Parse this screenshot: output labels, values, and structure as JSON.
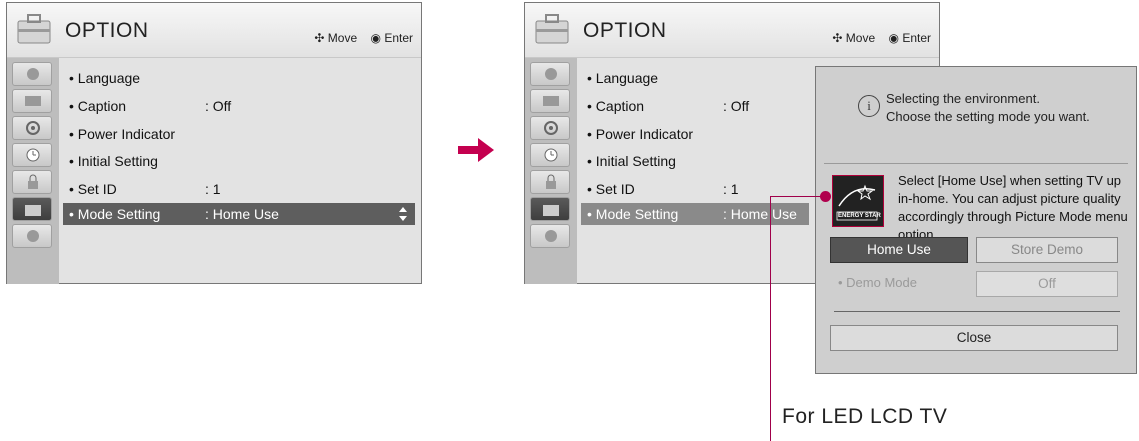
{
  "left_panel": {
    "title": "OPTION",
    "hint_move": "Move",
    "hint_enter": "Enter",
    "menu": [
      {
        "label": "• Language",
        "value": ""
      },
      {
        "label": "• Caption",
        "value": ": Off"
      },
      {
        "label": "• Power Indicator",
        "value": ""
      },
      {
        "label": "• Initial Setting",
        "value": ""
      },
      {
        "label": "• Set ID",
        "value": ": 1"
      },
      {
        "label": "• Mode Setting",
        "value": ": Home Use",
        "selected": true
      }
    ]
  },
  "right_panel": {
    "title": "OPTION",
    "hint_move": "Move",
    "hint_enter": "Enter",
    "menu": [
      {
        "label": "• Language",
        "value": ""
      },
      {
        "label": "• Caption",
        "value": ": Off"
      },
      {
        "label": "• Power Indicator",
        "value": ""
      },
      {
        "label": "• Initial Setting",
        "value": ""
      },
      {
        "label": "• Set ID",
        "value": ": 1"
      },
      {
        "label": "• Mode Setting",
        "value": ": Home Use",
        "selected": true
      }
    ]
  },
  "popup": {
    "info_line1": "Selecting the environment.",
    "info_line2": "Choose the setting mode you want.",
    "logo_text": "ENERGY STAR",
    "description": "Select [Home Use] when setting TV up in-home. You can adjust picture quality accordingly through Picture Mode menu option.",
    "home_use_label": "Home Use",
    "store_demo_label": "Store Demo",
    "demo_mode_label": "• Demo Mode",
    "demo_mode_value": "Off",
    "close_label": "Close"
  },
  "footnote": "For LED LCD TV",
  "colors": {
    "accent": "#c4004f",
    "selected_row": "#5e5e5e",
    "panel_bg": "#e3e3e3"
  },
  "icons": [
    "option-suitcase-icon",
    "move-arrows-icon",
    "enter-icon",
    "info-icon",
    "energy-star-logo",
    "arrow-right-icon"
  ]
}
